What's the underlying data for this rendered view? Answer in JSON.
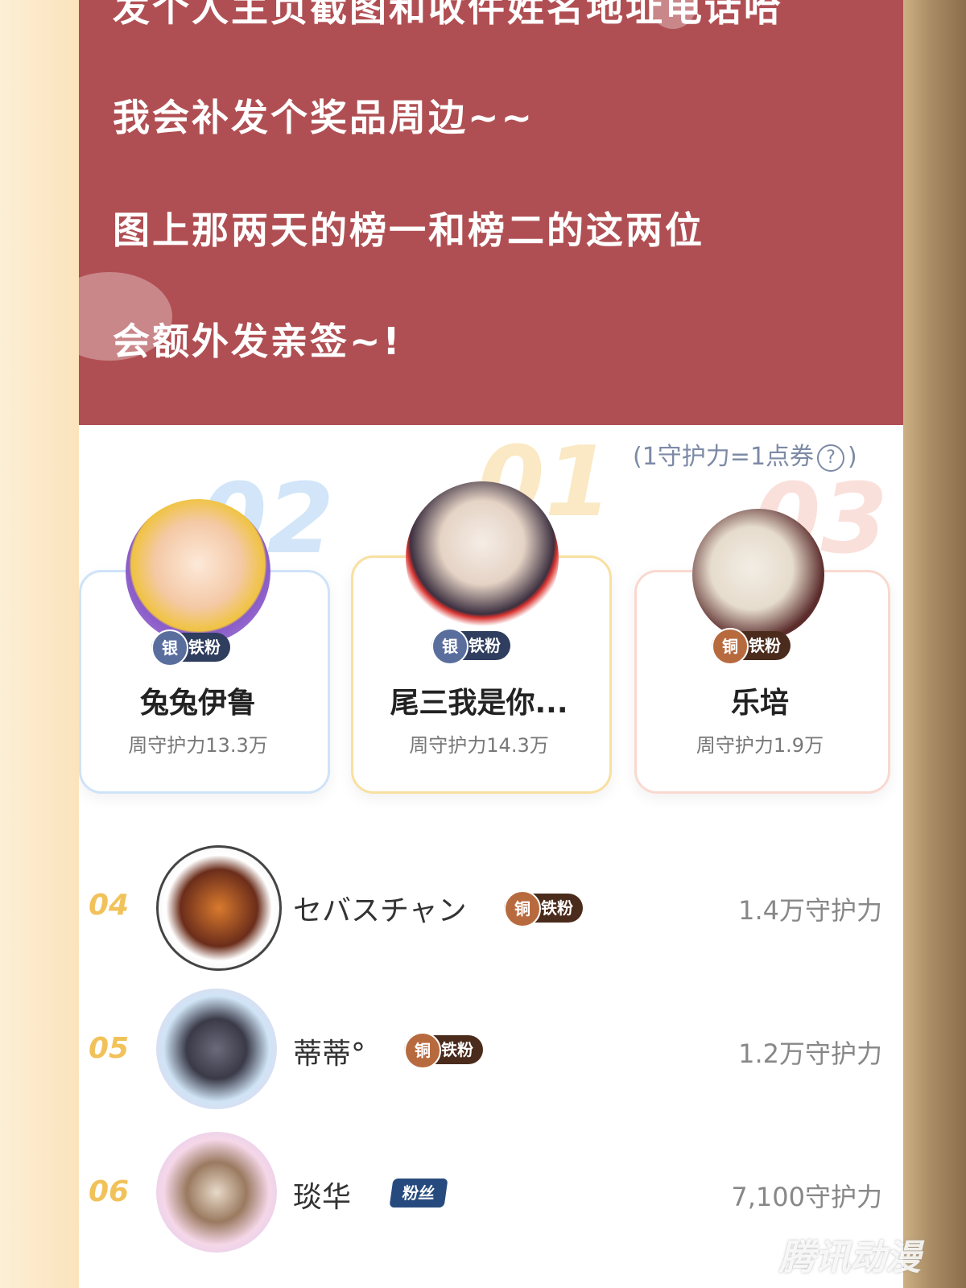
{
  "message": {
    "lines": [
      "发个人主页截图和收件姓名地址电话哈",
      "我会补发个奖品周边~~",
      "图上那两天的榜一和榜二的这两位",
      "会额外发亲签~!"
    ]
  },
  "ranking": {
    "rule_note": "1守护力=1点券",
    "podium": [
      {
        "rank_label": "02",
        "name": "兔兔伊鲁",
        "power": "周守护力13.3万",
        "badge_medal": "银",
        "badge_text": "铁粉",
        "badge_type": "silver"
      },
      {
        "rank_label": "01",
        "name": "尾三我是你...",
        "power": "周守护力14.3万",
        "badge_medal": "银",
        "badge_text": "铁粉",
        "badge_type": "silver"
      },
      {
        "rank_label": "03",
        "name": "乐培",
        "power": "周守护力1.9万",
        "badge_medal": "铜",
        "badge_text": "铁粉",
        "badge_type": "bronze"
      }
    ],
    "list": [
      {
        "rank_label": "04",
        "name": "セバスチャン",
        "badge_medal": "铜",
        "badge_text": "铁粉",
        "power": "1.4万守护力"
      },
      {
        "rank_label": "05",
        "name": "蒂蒂°",
        "badge_medal": "铜",
        "badge_text": "铁粉",
        "power": "1.2万守护力"
      },
      {
        "rank_label": "06",
        "name": "琰华",
        "badge_text": "粉丝",
        "power": "7,100守护力"
      }
    ]
  },
  "watermark": "腾讯动漫",
  "colors": {
    "message_bg": "#b04f53",
    "gold": "#f2c25a",
    "silver_blue": "#7fb6f0",
    "bronze": "#f3a99a"
  }
}
